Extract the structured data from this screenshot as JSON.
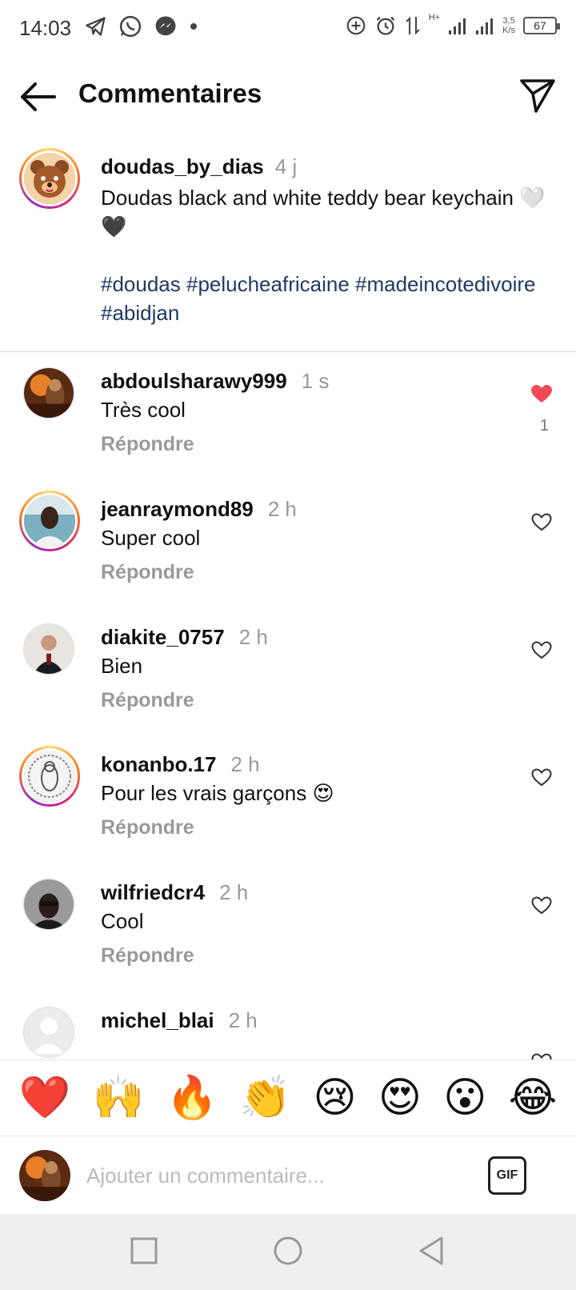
{
  "status_bar": {
    "time": "14:03",
    "battery": "67",
    "speed_value": "3,5",
    "speed_unit": "K/s",
    "network": "H+"
  },
  "header": {
    "title": "Commentaires"
  },
  "caption": {
    "username": "doudas_by_dias",
    "time": "4 j",
    "text": "Doudas black and white teddy bear keychain 🤍🖤",
    "hashtags": "#doudas #pelucheafricaine #madeincotedivoire #abidjan"
  },
  "comments": [
    {
      "username": "abdoulsharawy999",
      "time": "1 s",
      "text": "Très cool",
      "reply": "Répondre",
      "liked": true,
      "likes": "1"
    },
    {
      "username": "jeanraymond89",
      "time": "2 h",
      "text": "Super cool",
      "reply": "Répondre",
      "liked": false
    },
    {
      "username": "diakite_0757",
      "time": "2 h",
      "text": "Bien",
      "reply": "Répondre",
      "liked": false
    },
    {
      "username": "konanbo.17",
      "time": "2 h",
      "text": "Pour les vrais garçons 😍",
      "reply": "Répondre",
      "liked": false
    },
    {
      "username": "wilfriedcr4",
      "time": "2 h",
      "text": "Cool",
      "reply": "Répondre",
      "liked": false
    },
    {
      "username": "michel_blai",
      "time": "2 h"
    }
  ],
  "quick_emojis": [
    "❤️",
    "🙌",
    "🔥",
    "👏",
    "😢",
    "😍",
    "😮",
    "😂"
  ],
  "composer": {
    "placeholder": "Ajouter un commentaire...",
    "gif_label": "GIF"
  },
  "colors": {
    "like_red": "#ed4956",
    "hashtag": "#1e3a62",
    "muted": "#999999"
  }
}
